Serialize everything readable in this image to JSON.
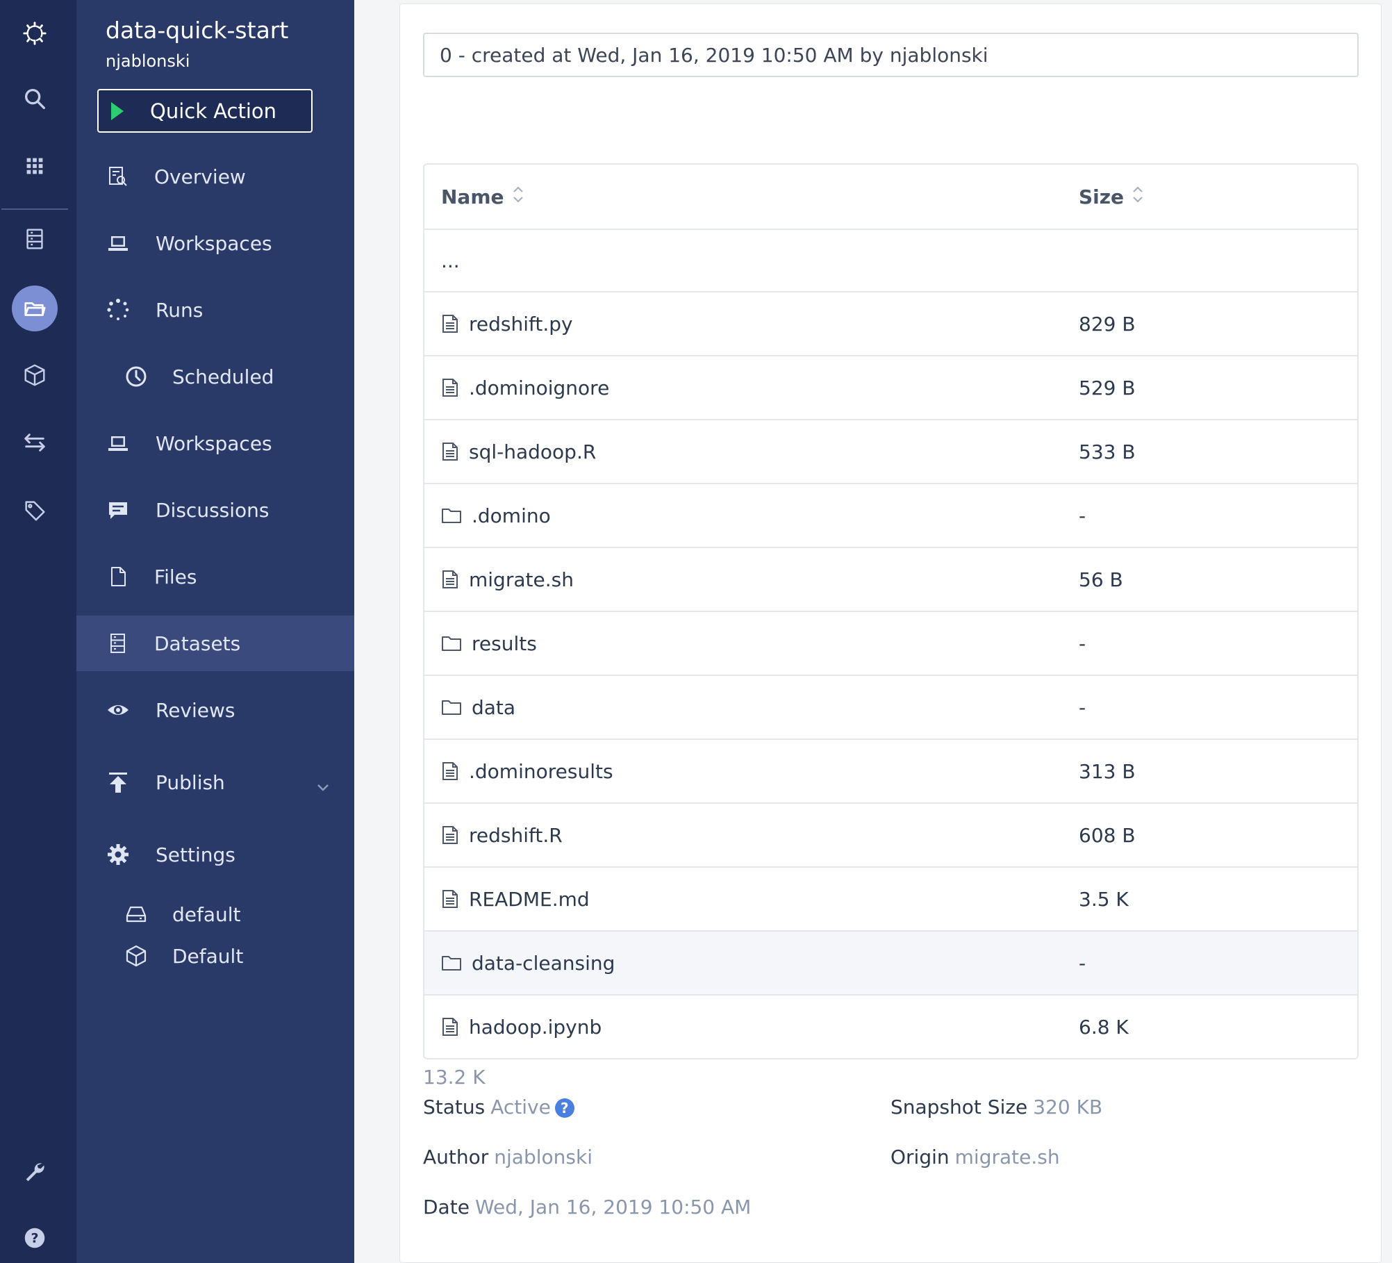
{
  "rail": {
    "icons": [
      "domino-logo-icon",
      "search-icon",
      "apps-grid-icon",
      "datasets-icon",
      "projects-folder-icon",
      "environments-cube-icon",
      "exchange-icon",
      "tag-icon",
      "wrench-icon",
      "help-icon"
    ],
    "help_label": "?"
  },
  "sidebar": {
    "project_title": "data-quick-start",
    "owner": "njablonski",
    "quick_action_label": "Quick Action",
    "items": [
      {
        "label": "Overview",
        "icon": "overview-icon"
      },
      {
        "label": "Workspaces",
        "icon": "laptop-icon"
      },
      {
        "label": "Runs",
        "icon": "spinner-icon"
      },
      {
        "label": "Scheduled",
        "icon": "clock-icon"
      },
      {
        "label": "Workspaces",
        "icon": "laptop-icon"
      },
      {
        "label": "Discussions",
        "icon": "chat-icon"
      },
      {
        "label": "Files",
        "icon": "file-icon"
      },
      {
        "label": "Datasets",
        "icon": "datasets-icon"
      },
      {
        "label": "Reviews",
        "icon": "eye-icon"
      },
      {
        "label": "Publish",
        "icon": "publish-icon"
      },
      {
        "label": "Settings",
        "icon": "gear-icon"
      },
      {
        "label": "default",
        "icon": "hardware-tier-icon"
      },
      {
        "label": "Default",
        "icon": "environment-cube-icon"
      }
    ]
  },
  "main": {
    "commit_text": "0 - created at Wed, Jan 16, 2019 10:50 AM by njablonski",
    "table": {
      "headers": {
        "name": "Name",
        "size": "Size"
      },
      "parent_row": "...",
      "rows": [
        {
          "name": "redshift.py",
          "size": "829 B",
          "type": "file"
        },
        {
          "name": ".dominoignore",
          "size": "529 B",
          "type": "file"
        },
        {
          "name": "sql-hadoop.R",
          "size": "533 B",
          "type": "file"
        },
        {
          "name": ".domino",
          "size": "-",
          "type": "folder"
        },
        {
          "name": "migrate.sh",
          "size": "56 B",
          "type": "file"
        },
        {
          "name": "results",
          "size": "-",
          "type": "folder"
        },
        {
          "name": "data",
          "size": "-",
          "type": "folder"
        },
        {
          "name": ".dominoresults",
          "size": "313 B",
          "type": "file"
        },
        {
          "name": "redshift.R",
          "size": "608 B",
          "type": "file"
        },
        {
          "name": "README.md",
          "size": "3.5 K",
          "type": "file"
        },
        {
          "name": "data-cleansing",
          "size": "-",
          "type": "folder"
        },
        {
          "name": "hadoop.ipynb",
          "size": "6.8 K",
          "type": "file"
        }
      ]
    },
    "total_size": "13.2 K",
    "details": {
      "status_label": "Status",
      "status_value": "Active",
      "status_help": "?",
      "snapshot_label": "Snapshot Size",
      "snapshot_value": "320 KB",
      "author_label": "Author",
      "author_value": "njablonski",
      "origin_label": "Origin",
      "origin_value": "migrate.sh",
      "date_label": "Date",
      "date_value": "Wed, Jan 16, 2019 10:50 AM"
    }
  }
}
